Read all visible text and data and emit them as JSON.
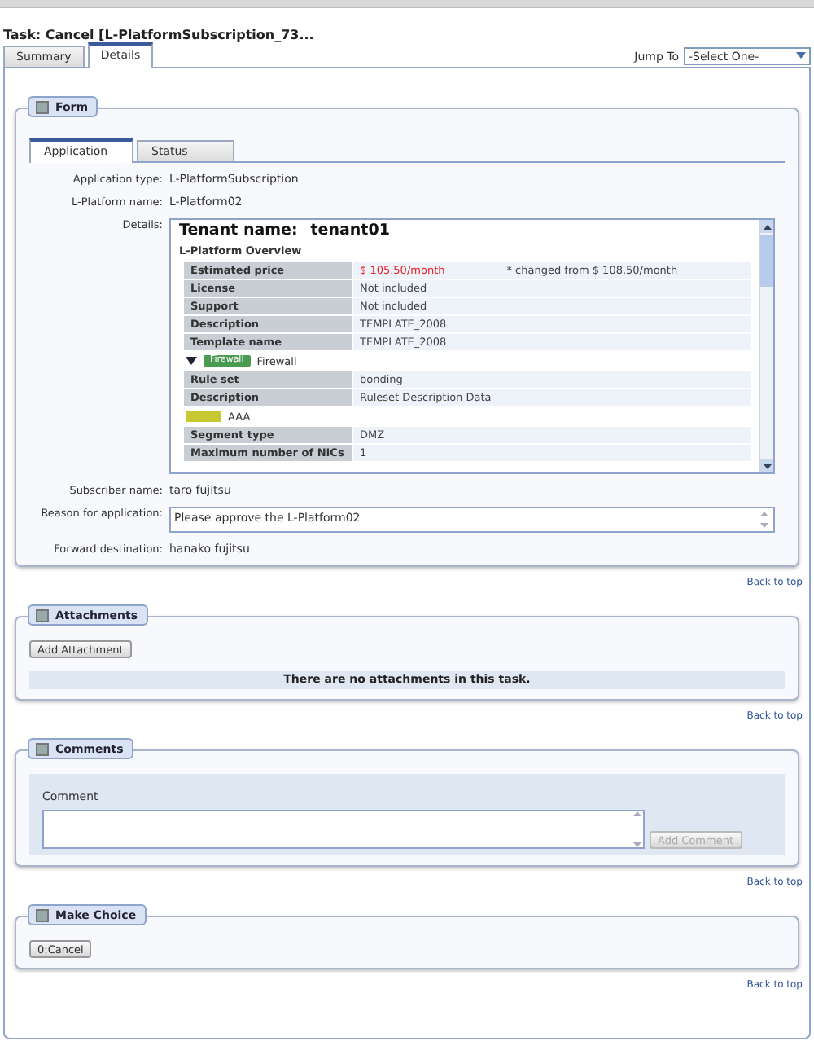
{
  "title": "Task: Cancel [L-PlatformSubscription_73...",
  "tabs": [
    {
      "label": "Summary",
      "selected": false
    },
    {
      "label": "Details",
      "selected": true
    }
  ],
  "jump_to": {
    "label": "Jump To",
    "value": "-Select One-"
  },
  "form": {
    "title": "Form",
    "tabs": [
      {
        "label": "Application",
        "selected": true
      },
      {
        "label": "Status",
        "selected": false
      }
    ],
    "fields": [
      {
        "label": "Application type:",
        "value": "L-PlatformSubscription"
      },
      {
        "label": "L-Platform name:",
        "value": "L-Platform02"
      }
    ],
    "details": {
      "label": "Details:",
      "tenant_label": "Tenant name:",
      "tenant_value": "tenant01",
      "overview_title": "L-Platform Overview",
      "overview_rows": [
        {
          "name": "Estimated price",
          "value": "$ 105.50/month",
          "changed": true,
          "note": "* changed from $ 108.50/month"
        },
        {
          "name": "License",
          "value": "Not included",
          "changed": false
        },
        {
          "name": "Support",
          "value": "Not included",
          "changed": false
        },
        {
          "name": "Description",
          "value": "TEMPLATE_2008",
          "changed": false
        },
        {
          "name": "Template name",
          "value": "TEMPLATE_2008",
          "changed": false
        }
      ],
      "groups": [
        {
          "kind": "collapsible",
          "expanded": true,
          "badge": "Firewall",
          "color": "#4a9a50",
          "name": "Firewall",
          "rows": [
            {
              "name": "Rule set",
              "value": "bonding"
            },
            {
              "name": "Description",
              "value": "Ruleset Description Data"
            }
          ]
        },
        {
          "kind": "plain",
          "color": "#c8c832",
          "name": "AAA",
          "rows": [
            {
              "name": "Segment type",
              "value": "DMZ"
            },
            {
              "name": "Maximum number of NICs",
              "value": "1"
            }
          ]
        }
      ]
    },
    "subscriber": {
      "label": "Subscriber name:",
      "value": "taro fujitsu"
    },
    "reason": {
      "label": "Reason for application:",
      "value": "Please approve the L-Platform02"
    },
    "forward": {
      "label": "Forward destination:",
      "value": "hanako fujitsu"
    },
    "back_to_top": "Back to top"
  },
  "attachments": {
    "title": "Attachments",
    "button": "Add Attachment",
    "empty_message": "There are no attachments in this task.",
    "back_to_top": "Back to top"
  },
  "comments": {
    "title": "Comments",
    "label": "Comment",
    "button": "Add Comment",
    "button_disabled": true,
    "back_to_top": "Back to top"
  },
  "make_choice": {
    "title": "Make Choice",
    "buttons": [
      "0:Cancel"
    ],
    "back_to_top": "Back to top"
  }
}
